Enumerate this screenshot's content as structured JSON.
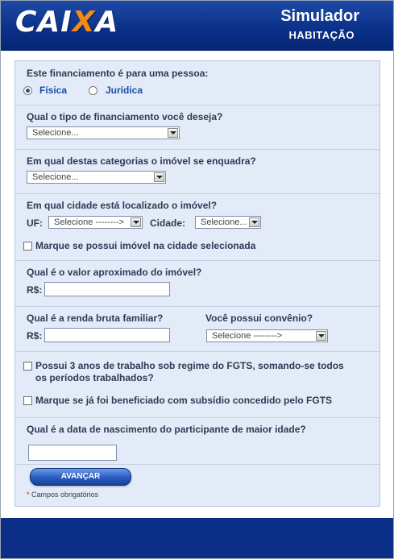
{
  "header": {
    "logo": "CAIXA",
    "title": "Simulador",
    "subtitle": "HABITAÇÃO"
  },
  "pessoa": {
    "question": "Este financiamento é para uma pessoa:",
    "options": [
      "Física",
      "Jurídica"
    ],
    "selected": "Física"
  },
  "tipo": {
    "question": "Qual o tipo de financiamento você deseja?",
    "selected": "Selecione..."
  },
  "categoria": {
    "question": "Em qual destas categorias o imóvel se enquadra?",
    "selected": "Selecione..."
  },
  "cidade": {
    "question": "Em qual cidade está localizado o imóvel?",
    "uf_label": "UF:",
    "uf_selected": "Selecione -------->",
    "cidade_label": "Cidade:",
    "cidade_selected": "Selecione...",
    "checkbox_label": "Marque se possui imóvel na cidade selecionada"
  },
  "valor": {
    "question": "Qual é o valor aproximado do imóvel?",
    "currency": "R$:",
    "value": ""
  },
  "renda": {
    "question": "Qual é a renda bruta familiar?",
    "currency": "R$:",
    "value": ""
  },
  "convenio": {
    "question": "Você possui convênio?",
    "selected": "Selecione -------->"
  },
  "fgts": {
    "line1": "Possui 3 anos de trabalho sob regime do FGTS, somando-se todos",
    "line2": "os períodos trabalhados?",
    "subsidio_label": "Marque se já foi beneficiado com subsídio concedido pelo FGTS"
  },
  "nascimento": {
    "question": "Qual é a data de nascimento do participante de maior idade?",
    "value": ""
  },
  "actions": {
    "submit": "AVANÇAR",
    "required_mark": "*",
    "required_note": "Campos obrigatórios"
  },
  "colors": {
    "brand_blue": "#0b2e86",
    "logo_accent": "#f28a14",
    "panel_bg": "#e4ebf8",
    "label_text": "#2e3a55",
    "required_star": "#d42020"
  }
}
